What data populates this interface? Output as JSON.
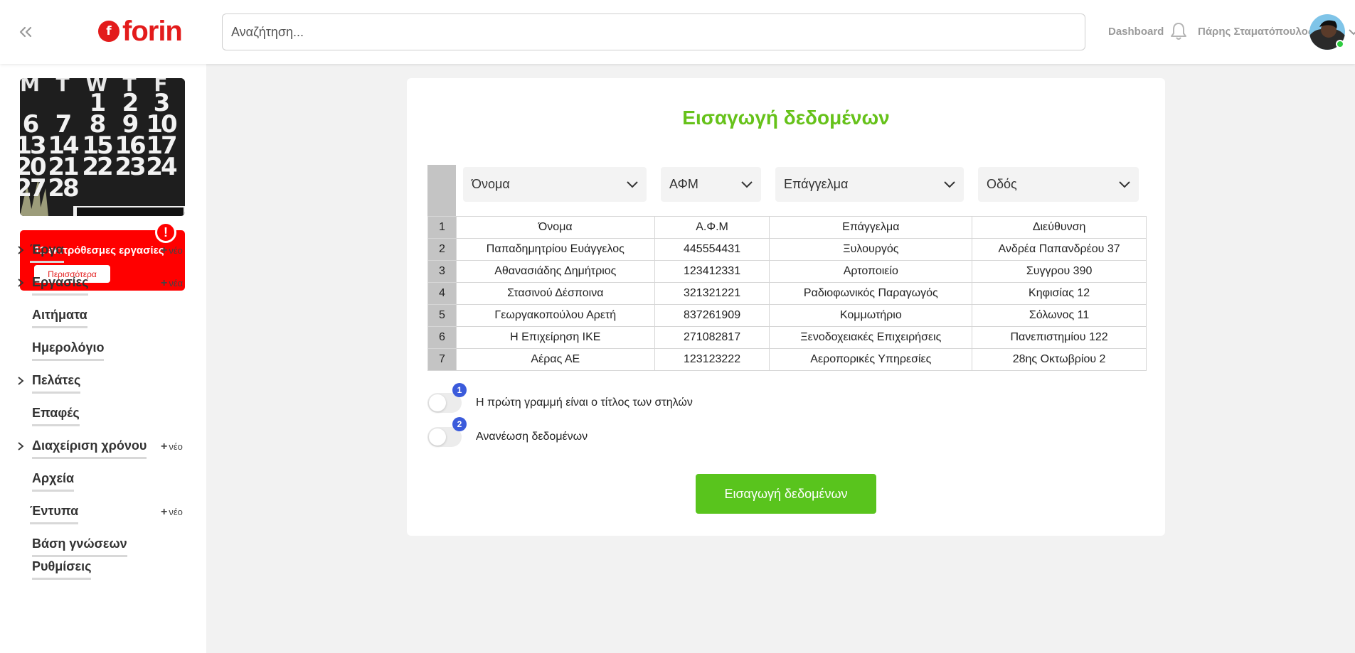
{
  "header": {
    "brand": "forin",
    "brand_mark": "f",
    "search_placeholder": "Αναζήτηση...",
    "dashboard_label": "Dashboard",
    "user_name": "Πάρης Σταματόπουλος"
  },
  "sidebar": {
    "calendar": {
      "days": [
        "M",
        "T",
        "W",
        "T",
        "F"
      ],
      "rows": [
        [
          "",
          "",
          "1",
          "2",
          "3"
        ],
        [
          "6",
          "7",
          "8",
          "9",
          "10"
        ],
        [
          "13",
          "14",
          "15",
          "16",
          "17"
        ],
        [
          "20",
          "21",
          "22",
          "23",
          "24"
        ],
        [
          "27",
          "28",
          "",
          "",
          ""
        ]
      ]
    },
    "alert": {
      "text": "11 εκπρόθεσμες εργασίες",
      "more_label": "Περισσότερα",
      "badge": "!"
    },
    "items": [
      {
        "label": "Έργα",
        "chevron": true,
        "new_label": "νέο"
      },
      {
        "label": "Εργασίες",
        "chevron": true,
        "new_label": "νέα"
      },
      {
        "label": "Αιτήματα",
        "chevron": false,
        "new_label": ""
      },
      {
        "label": "Ημερολόγιο",
        "chevron": false,
        "new_label": ""
      },
      {
        "label": "Πελάτες",
        "chevron": true,
        "new_label": ""
      },
      {
        "label": "Επαφές",
        "chevron": false,
        "new_label": ""
      },
      {
        "label": "Διαχείριση χρόνου",
        "chevron": true,
        "new_label": "νέο"
      },
      {
        "label": "Αρχεία",
        "chevron": false,
        "new_label": ""
      },
      {
        "label": "Έντυπα",
        "chevron": false,
        "new_label": "νέο"
      },
      {
        "label": "Βάση γνώσεων",
        "chevron": false,
        "new_label": ""
      },
      {
        "label": "Ρυθμίσεις",
        "chevron": false,
        "new_label": ""
      }
    ]
  },
  "main": {
    "title": "Εισαγωγή δεδομένων",
    "column_selects": [
      "Όνομα",
      "ΑΦΜ",
      "Επάγγελμα",
      "Οδός"
    ],
    "rows": [
      [
        "1",
        "Όνομα",
        "Α.Φ.Μ",
        "Επάγγελμα",
        "Διεύθυνση"
      ],
      [
        "2",
        "Παπαδημητρίου Ευάγγελος",
        "445554431",
        "Ξυλουργός",
        "Ανδρέα Παπανδρέου 37"
      ],
      [
        "3",
        "Αθανασιάδης Δημήτριος",
        "123412331",
        "Αρτοποιείο",
        "Συγγρου 390"
      ],
      [
        "4",
        "Στασινού Δέσποινα",
        "321321221",
        "Ραδιοφωνικός Παραγωγός",
        "Κηφισίας 12"
      ],
      [
        "5",
        "Γεωργακοπούλου Αρετή",
        "837261909",
        "Κομμωτήριο",
        "Σόλωνος 11"
      ],
      [
        "6",
        "Η Επιχείρηση ΙΚΕ",
        "271082817",
        "Ξενοδοχειακές Επιχειρήσεις",
        "Πανεπιστημίου 122"
      ],
      [
        "7",
        "Αέρας ΑΕ",
        "123123222",
        "Αεροπορικές Υπηρεσίες",
        "28ης Οκτωβρίου 2"
      ]
    ],
    "toggles": [
      {
        "badge": "1",
        "label": "Η πρώτη γραμμή είναι ο τίτλος των στηλών"
      },
      {
        "badge": "2",
        "label": "Ανανέωση δεδομένων"
      }
    ],
    "submit_label": "Εισαγωγή δεδομένων"
  },
  "colors": {
    "brand_red": "#e31b1b",
    "alert_red": "#ff0000",
    "title_green": "#66c21a",
    "button_green": "#59c41d",
    "badge_blue": "#3b5bdb"
  }
}
